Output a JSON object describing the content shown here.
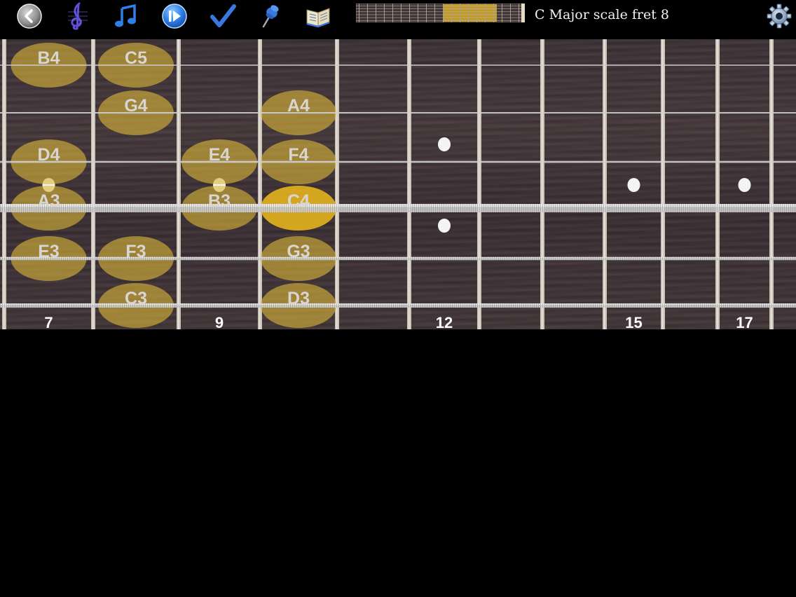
{
  "toolbar": {
    "title": "C Major scale fret 8",
    "buttons": [
      {
        "name": "back-button",
        "icon": "back-arrow-icon"
      },
      {
        "name": "clef-button",
        "icon": "treble-clef-icon"
      },
      {
        "name": "notes-button",
        "icon": "music-note-icon"
      },
      {
        "name": "play-button",
        "icon": "play-icon"
      },
      {
        "name": "check-button",
        "icon": "checkmark-icon"
      },
      {
        "name": "pin-button",
        "icon": "pushpin-icon"
      },
      {
        "name": "book-button",
        "icon": "book-icon"
      },
      {
        "name": "settings-button",
        "icon": "gear-icon"
      }
    ]
  },
  "fretboard": {
    "fret_numbers": [
      {
        "fret": 7,
        "label": "7"
      },
      {
        "fret": 9,
        "label": "9"
      },
      {
        "fret": 12,
        "label": "12"
      },
      {
        "fret": 15,
        "label": "15"
      },
      {
        "fret": 17,
        "label": "17"
      }
    ],
    "notes": [
      {
        "label": "B4",
        "string": 1,
        "fret": 7,
        "highlight": false
      },
      {
        "label": "C5",
        "string": 1,
        "fret": 8,
        "highlight": false
      },
      {
        "label": "G4",
        "string": 2,
        "fret": 8,
        "highlight": false
      },
      {
        "label": "A4",
        "string": 2,
        "fret": 10,
        "highlight": false
      },
      {
        "label": "D4",
        "string": 3,
        "fret": 7,
        "highlight": false
      },
      {
        "label": "E4",
        "string": 3,
        "fret": 9,
        "highlight": false
      },
      {
        "label": "F4",
        "string": 3,
        "fret": 10,
        "highlight": false
      },
      {
        "label": "A3",
        "string": 4,
        "fret": 7,
        "highlight": false
      },
      {
        "label": "B3",
        "string": 4,
        "fret": 9,
        "highlight": false
      },
      {
        "label": "C4",
        "string": 4,
        "fret": 10,
        "highlight": true
      },
      {
        "label": "E3",
        "string": 5,
        "fret": 7,
        "highlight": false
      },
      {
        "label": "F3",
        "string": 5,
        "fret": 8,
        "highlight": false
      },
      {
        "label": "G3",
        "string": 5,
        "fret": 10,
        "highlight": false
      },
      {
        "label": "C3",
        "string": 6,
        "fret": 8,
        "highlight": false
      },
      {
        "label": "D3",
        "string": 6,
        "fret": 10,
        "highlight": false
      }
    ],
    "inlays": [
      7,
      9,
      12,
      15,
      17
    ],
    "double_inlays": [
      12
    ]
  },
  "colors": {
    "note_fill": "#d9b43a",
    "note_highlight": "#e2b01e",
    "fret_wire": "#c9c3b8",
    "string": "#d0d0d0",
    "inlay": "#f4f4f4"
  }
}
